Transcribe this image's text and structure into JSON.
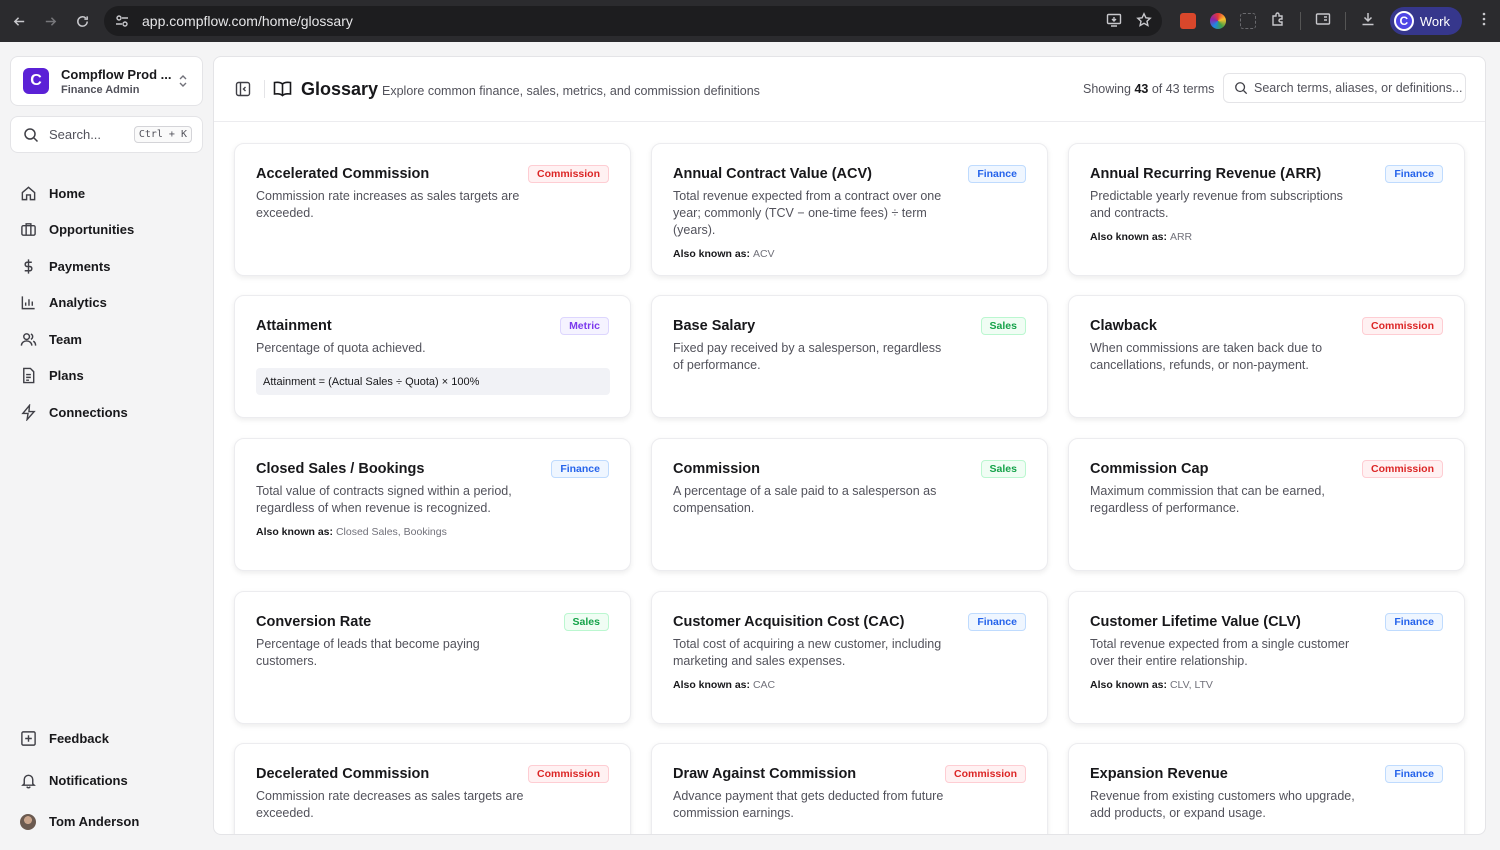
{
  "browser": {
    "url": "app.compflow.com/home/glossary",
    "profile_label": "Work",
    "profile_initial": "C"
  },
  "sidebar": {
    "org_initial": "C",
    "org_name": "Compflow Prod ...",
    "org_role": "Finance Admin",
    "search_placeholder": "Search...",
    "search_shortcut": "Ctrl + K",
    "nav": [
      {
        "label": "Home",
        "icon": "home-icon"
      },
      {
        "label": "Opportunities",
        "icon": "briefcase-icon"
      },
      {
        "label": "Payments",
        "icon": "dollar-icon"
      },
      {
        "label": "Analytics",
        "icon": "bar-chart-icon"
      },
      {
        "label": "Team",
        "icon": "users-icon"
      },
      {
        "label": "Plans",
        "icon": "document-icon"
      },
      {
        "label": "Connections",
        "icon": "lightning-icon"
      }
    ],
    "bottom": [
      {
        "label": "Feedback",
        "icon": "feedback-icon"
      },
      {
        "label": "Notifications",
        "icon": "bell-icon"
      },
      {
        "label": "Tom Anderson",
        "icon": "avatar"
      }
    ]
  },
  "header": {
    "title": "Glossary",
    "subtitle": "Explore common finance, sales, metrics, and commission definitions",
    "count_prefix": "Showing",
    "count_shown": "43",
    "count_middle": "of 43 terms",
    "search_placeholder": "Search terms, aliases, or definitions..."
  },
  "aka_label": "Also known as:",
  "colors": {
    "brand": "#5b21d6",
    "commission": "#dc2626",
    "finance": "#2563eb",
    "metric": "#7c3aed",
    "sales": "#16a34a"
  },
  "cards": [
    {
      "term": "Accelerated Commission",
      "category": "Commission",
      "definition": "Commission rate increases as sales targets are exceeded."
    },
    {
      "term": "Annual Contract Value (ACV)",
      "category": "Finance",
      "definition": "Total revenue expected from a contract over one year; commonly (TCV − one-time fees) ÷ term (years).",
      "aka": "ACV"
    },
    {
      "term": "Annual Recurring Revenue (ARR)",
      "category": "Finance",
      "definition": "Predictable yearly revenue from subscriptions and contracts.",
      "aka": "ARR"
    },
    {
      "term": "Attainment",
      "category": "Metric",
      "definition": "Percentage of quota achieved.",
      "formula": "Attainment = (Actual Sales ÷ Quota) × 100%"
    },
    {
      "term": "Base Salary",
      "category": "Sales",
      "definition": "Fixed pay received by a salesperson, regardless of performance."
    },
    {
      "term": "Clawback",
      "category": "Commission",
      "definition": "When commissions are taken back due to cancellations, refunds, or non-payment."
    },
    {
      "term": "Closed Sales / Bookings",
      "category": "Finance",
      "definition": "Total value of contracts signed within a period, regardless of when revenue is recognized.",
      "aka": "Closed Sales, Bookings"
    },
    {
      "term": "Commission",
      "category": "Sales",
      "definition": "A percentage of a sale paid to a salesperson as compensation."
    },
    {
      "term": "Commission Cap",
      "category": "Commission",
      "definition": "Maximum commission that can be earned, regardless of performance."
    },
    {
      "term": "Conversion Rate",
      "category": "Sales",
      "definition": "Percentage of leads that become paying customers."
    },
    {
      "term": "Customer Acquisition Cost (CAC)",
      "category": "Finance",
      "definition": "Total cost of acquiring a new customer, including marketing and sales expenses.",
      "aka": "CAC"
    },
    {
      "term": "Customer Lifetime Value (CLV)",
      "category": "Finance",
      "definition": "Total revenue expected from a single customer over their entire relationship.",
      "aka": "CLV, LTV"
    },
    {
      "term": "Decelerated Commission",
      "category": "Commission",
      "definition": "Commission rate decreases as sales targets are exceeded."
    },
    {
      "term": "Draw Against Commission",
      "category": "Commission",
      "definition": "Advance payment that gets deducted from future commission earnings."
    },
    {
      "term": "Expansion Revenue",
      "category": "Finance",
      "definition": "Revenue from existing customers who upgrade, add products, or expand usage."
    }
  ]
}
